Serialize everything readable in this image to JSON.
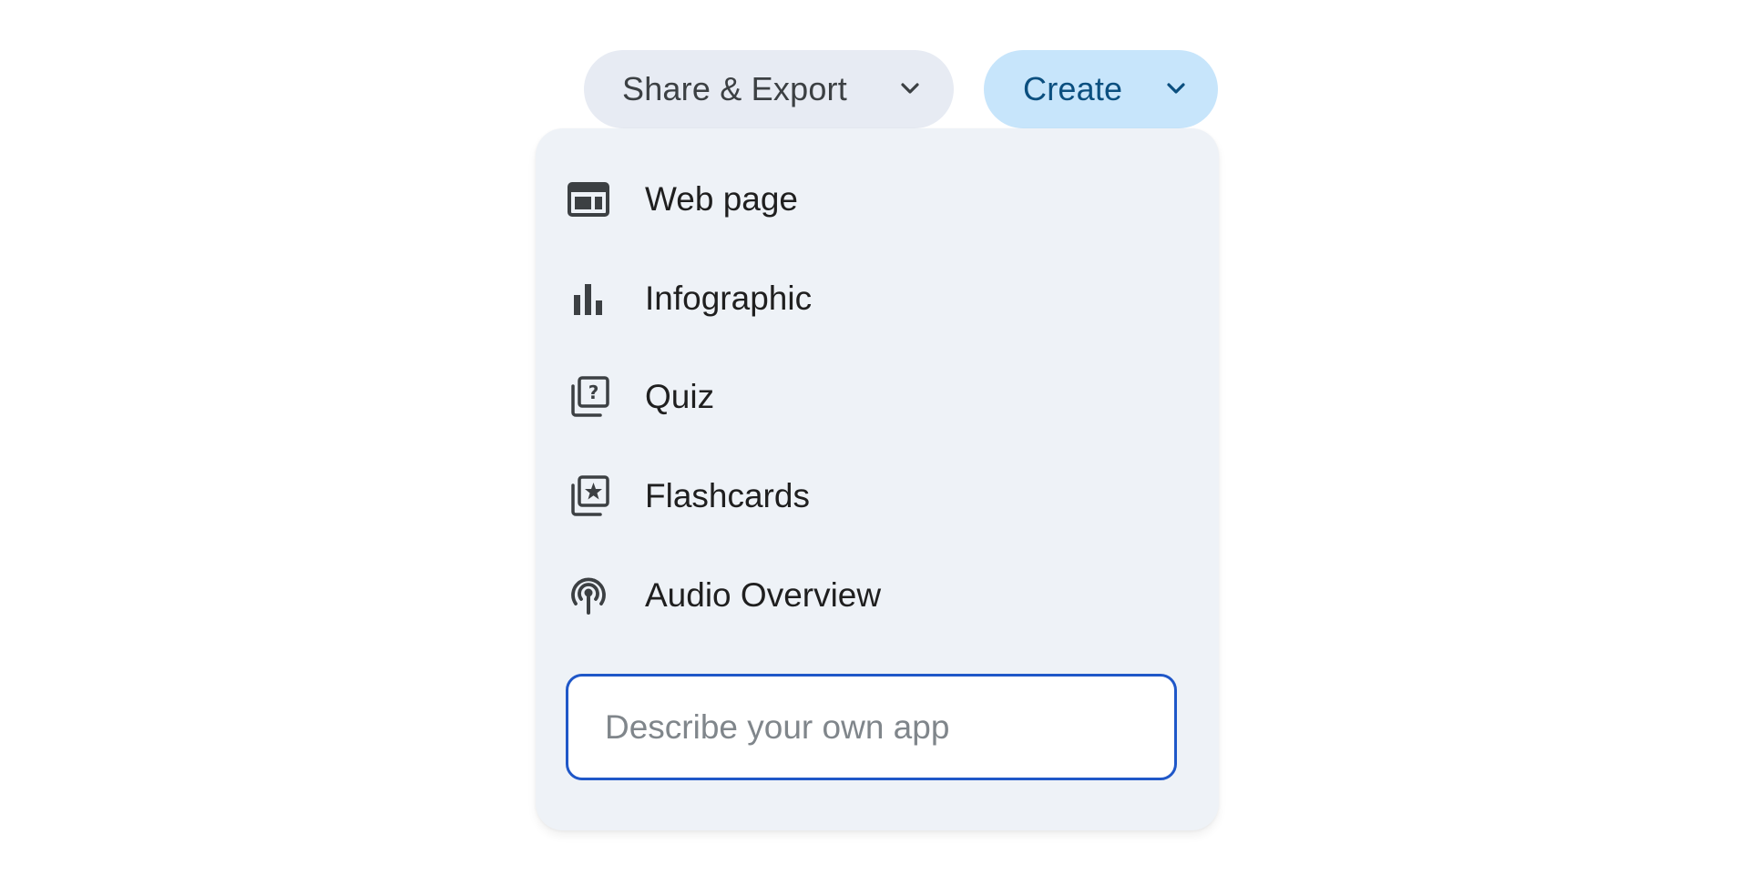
{
  "toolbar": {
    "share_export_label": "Share & Export",
    "create_label": "Create"
  },
  "create_menu": {
    "items": [
      {
        "label": "Web page",
        "icon": "web-page-icon"
      },
      {
        "label": "Infographic",
        "icon": "bar-chart-icon"
      },
      {
        "label": "Quiz",
        "icon": "quiz-icon"
      },
      {
        "label": "Flashcards",
        "icon": "flashcards-icon"
      },
      {
        "label": "Audio Overview",
        "icon": "podcast-icon"
      }
    ],
    "describe_input": {
      "placeholder": "Describe your own app",
      "value": ""
    }
  },
  "colors": {
    "share_button_bg": "#e7ebf3",
    "create_button_bg": "#c7e5fb",
    "create_button_text": "#0b4f7f",
    "menu_bg": "#eef2f7",
    "input_border": "#1f57c8"
  }
}
